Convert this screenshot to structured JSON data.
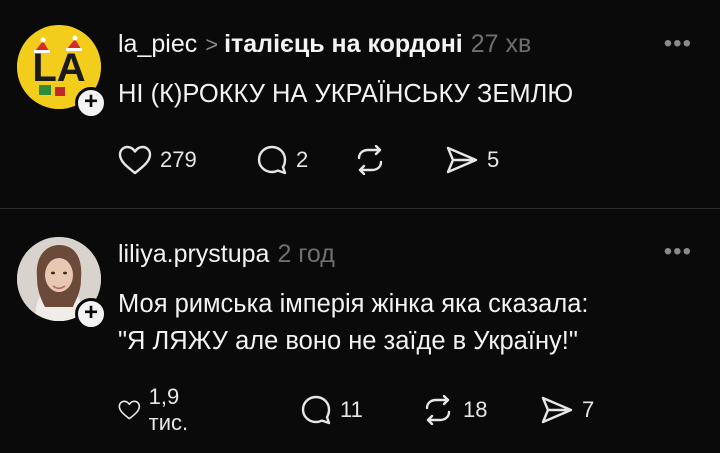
{
  "posts": [
    {
      "username": "la_piec",
      "separator": ">",
      "community": "італієць на кордоні",
      "time": "27 хв",
      "more_icon": "more-horizontal-icon",
      "avatar_text": "LA",
      "text": "НІ (К)РОККУ НА УКРАЇНСЬКУ ЗЕМЛЮ",
      "likes": "279",
      "comments": "2",
      "reposts": "",
      "shares": "5"
    },
    {
      "username": "liliya.prystupa",
      "time": "2 год",
      "more_icon": "more-horizontal-icon",
      "text_lines": [
        "Моя римська імперія жінка яка сказала:",
        "\"Я ЛЯЖУ але воно не заїде в Україну!\""
      ],
      "likes": "1,9 тис.",
      "comments": "11",
      "reposts": "18",
      "shares": "7"
    }
  ],
  "colors": {
    "background": "#0a0a0a",
    "text": "#f3f3f3",
    "muted": "#6f6f6f",
    "divider": "#2b2b2b",
    "avatar_yellow": "#f2cd1c"
  }
}
